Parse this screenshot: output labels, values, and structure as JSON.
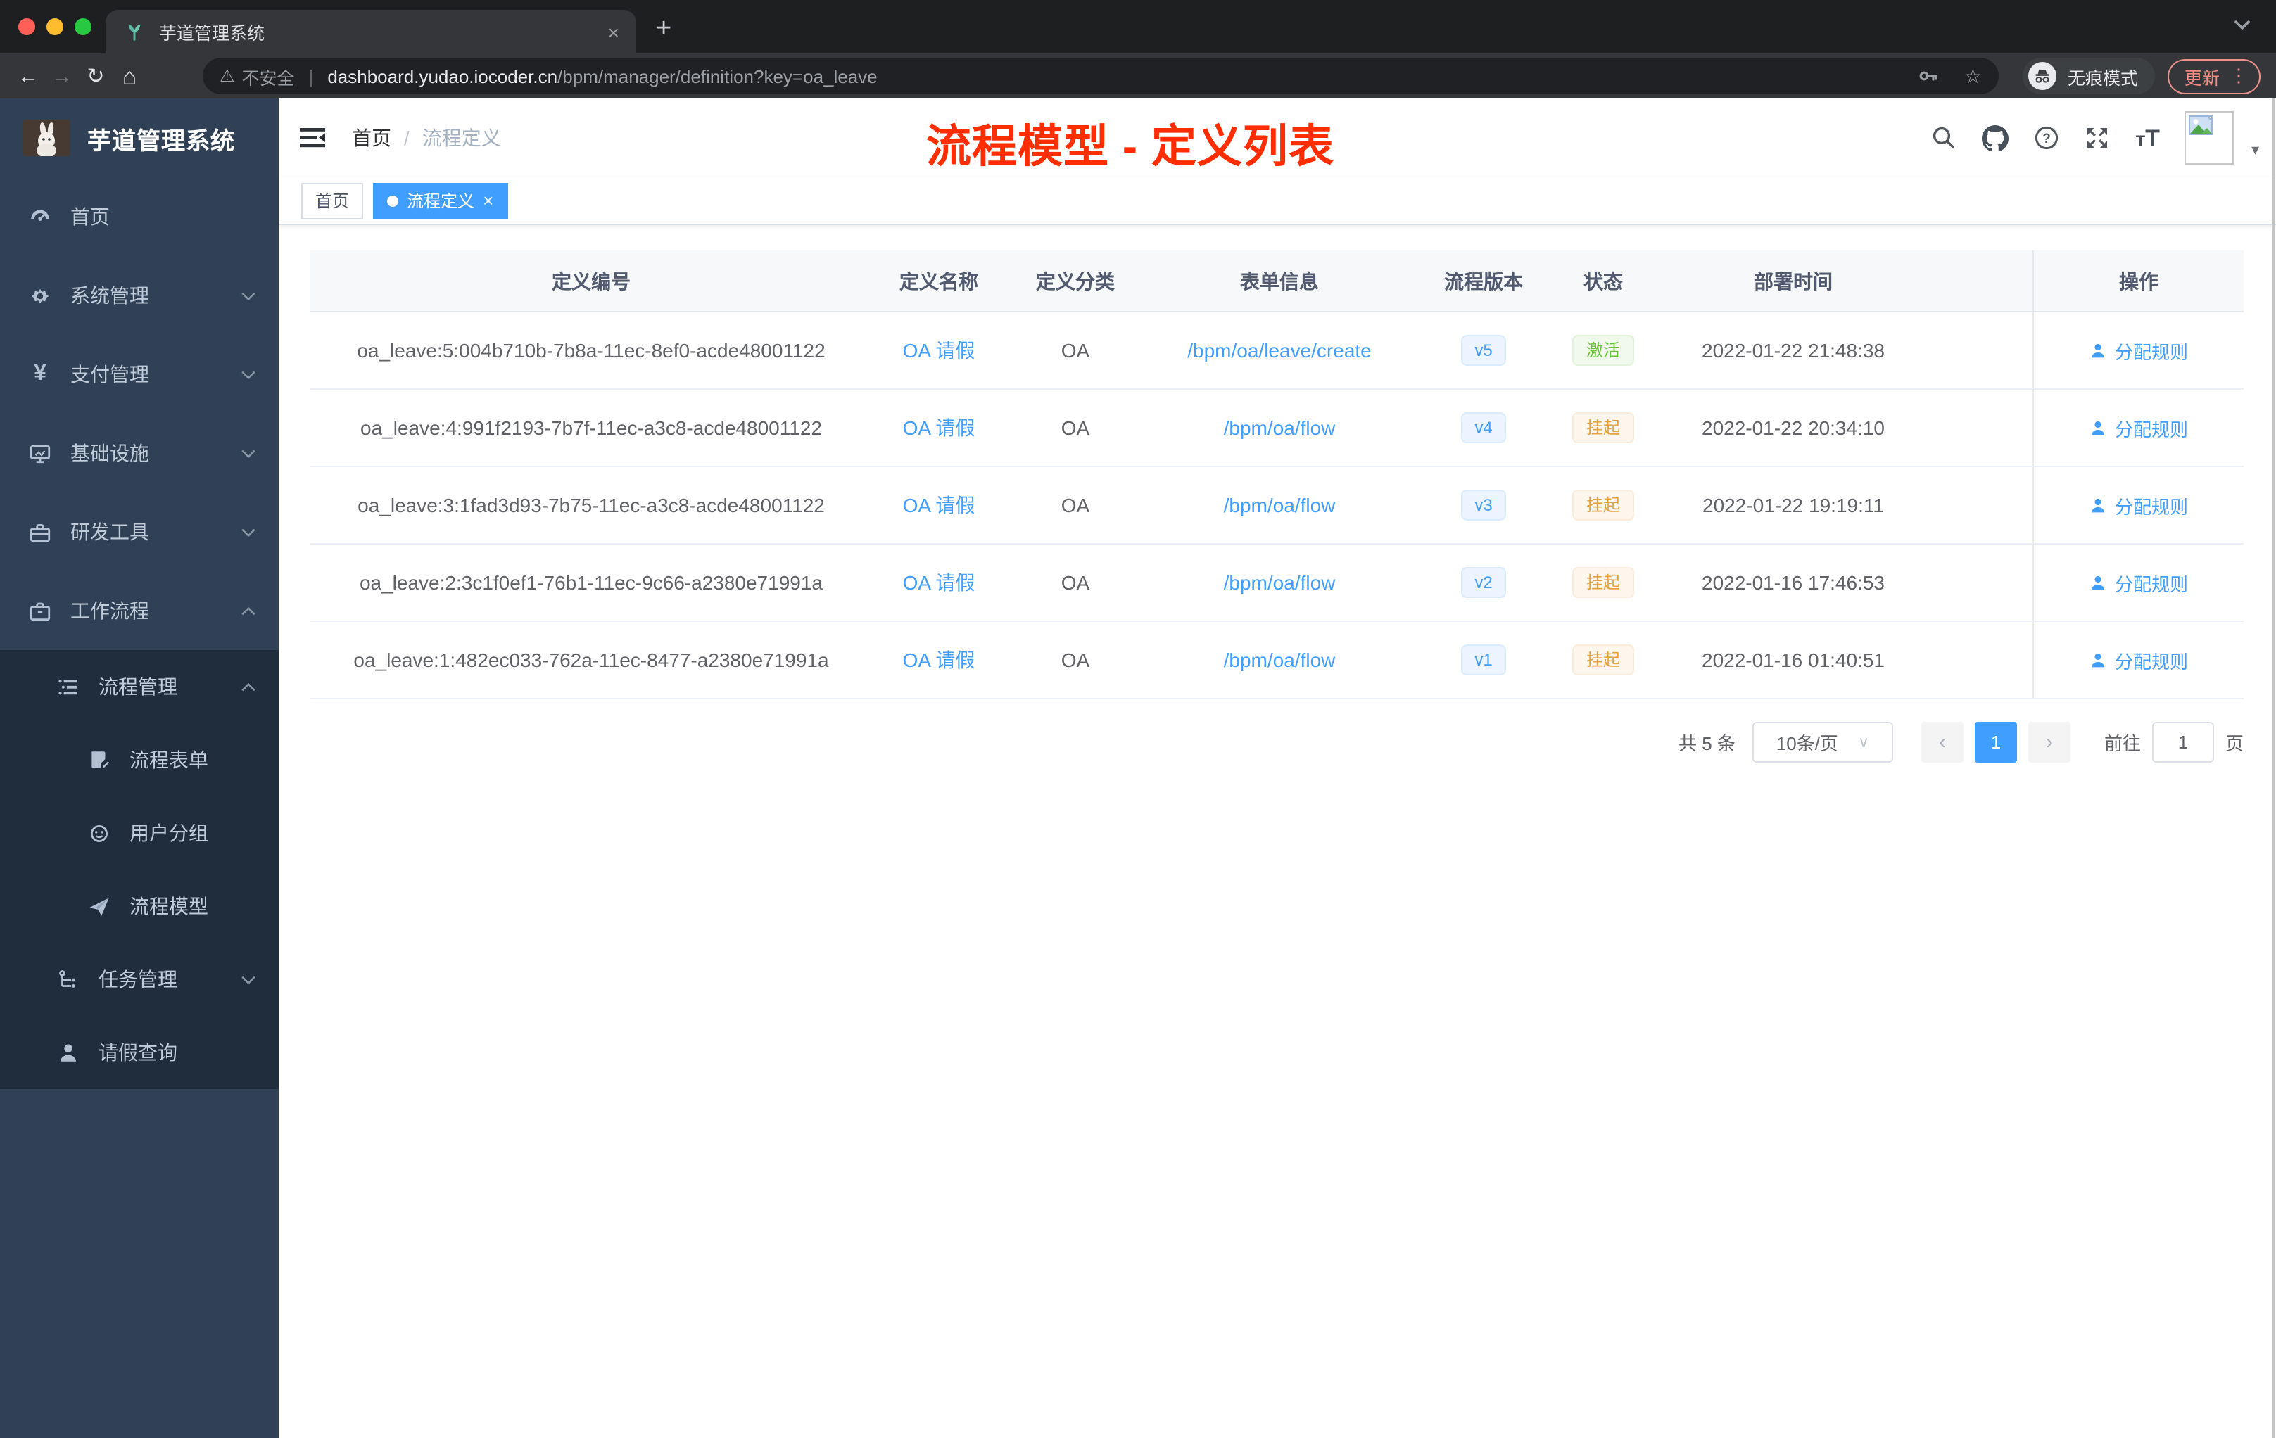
{
  "browser": {
    "tab_title": "芋道管理系统",
    "security_label": "不安全",
    "url_host": "dashboard.yudao.iocoder.cn",
    "url_path": "/bpm/manager/definition?key=oa_leave",
    "incognito_label": "无痕模式",
    "update_label": "更新",
    "icons": {
      "close": "×",
      "new_tab": "+",
      "back": "←",
      "forward": "→",
      "reload": "↻",
      "home": "⌂",
      "warning": "⚠",
      "divider": "|",
      "key": "⌐",
      "star": "☆",
      "more": "⋮",
      "caret": "▾"
    }
  },
  "sidebar": {
    "logo_title": "芋道管理系统",
    "items": [
      {
        "label": "首页",
        "icon": "dashboard-icon"
      },
      {
        "label": "系统管理",
        "icon": "gear-icon",
        "expandable": true
      },
      {
        "label": "支付管理",
        "icon": "yen-icon",
        "expandable": true
      },
      {
        "label": "基础设施",
        "icon": "monitor-icon",
        "expandable": true
      },
      {
        "label": "研发工具",
        "icon": "toolbox-icon",
        "expandable": true
      },
      {
        "label": "工作流程",
        "icon": "briefcase-icon",
        "expandable": true,
        "expanded": true
      },
      {
        "label": "流程管理",
        "icon": "list-icon",
        "expandable": true,
        "expanded": true,
        "level": 2
      },
      {
        "label": "流程表单",
        "icon": "form-icon",
        "level": 3
      },
      {
        "label": "用户分组",
        "icon": "group-icon",
        "level": 3
      },
      {
        "label": "流程模型",
        "icon": "paper-plane-icon",
        "level": 3
      },
      {
        "label": "任务管理",
        "icon": "tasks-icon",
        "expandable": true,
        "level": 2
      },
      {
        "label": "请假查询",
        "icon": "person-icon",
        "level": 2
      }
    ]
  },
  "header": {
    "breadcrumb": {
      "home": "首页",
      "separator": "/",
      "current": "流程定义"
    },
    "annotation": "流程模型 - 定义列表"
  },
  "tags": {
    "home": "首页",
    "active": "流程定义"
  },
  "table": {
    "headers": [
      "定义编号",
      "定义名称",
      "定义分类",
      "表单信息",
      "流程版本",
      "状态",
      "部署时间",
      "操作"
    ],
    "action_label": "分配规则",
    "rows": [
      {
        "id": "oa_leave:5:004b710b-7b8a-11ec-8ef0-acde48001122",
        "name": "OA 请假",
        "category": "OA",
        "form": "/bpm/oa/leave/create",
        "version": "v5",
        "status_label": "激活",
        "status_class": "status-success",
        "deploy_time": "2022-01-22 21:48:38"
      },
      {
        "id": "oa_leave:4:991f2193-7b7f-11ec-a3c8-acde48001122",
        "name": "OA 请假",
        "category": "OA",
        "form": "/bpm/oa/flow",
        "version": "v4",
        "status_label": "挂起",
        "status_class": "status-warning",
        "deploy_time": "2022-01-22 20:34:10"
      },
      {
        "id": "oa_leave:3:1fad3d93-7b75-11ec-a3c8-acde48001122",
        "name": "OA 请假",
        "category": "OA",
        "form": "/bpm/oa/flow",
        "version": "v3",
        "status_label": "挂起",
        "status_class": "status-warning",
        "deploy_time": "2022-01-22 19:19:11"
      },
      {
        "id": "oa_leave:2:3c1f0ef1-76b1-11ec-9c66-a2380e71991a",
        "name": "OA 请假",
        "category": "OA",
        "form": "/bpm/oa/flow",
        "version": "v2",
        "status_label": "挂起",
        "status_class": "status-warning",
        "deploy_time": "2022-01-16 17:46:53"
      },
      {
        "id": "oa_leave:1:482ec033-762a-11ec-8477-a2380e71991a",
        "name": "OA 请假",
        "category": "OA",
        "form": "/bpm/oa/flow",
        "version": "v1",
        "status_label": "挂起",
        "status_class": "status-warning",
        "deploy_time": "2022-01-16 01:40:51"
      }
    ]
  },
  "pagination": {
    "total": "共 5 条",
    "page_size": "10条/页",
    "prev": "‹",
    "next": "›",
    "select_caret": "∨",
    "page": "1",
    "goto_label": "前往",
    "goto_value": "1",
    "page_suffix": "页"
  },
  "colors": {
    "primary": "#409eff",
    "success": "#67c23a",
    "warning": "#e6a23c",
    "annotation_red": "#ff2d02",
    "sidebar_bg": "#304156",
    "submenu_bg": "#1f2d3d"
  }
}
